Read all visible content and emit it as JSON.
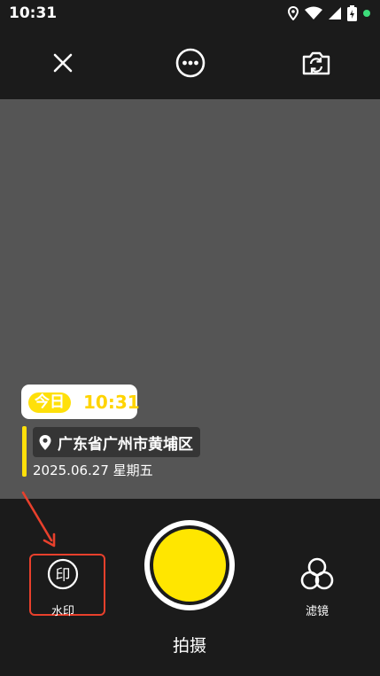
{
  "status_bar": {
    "time": "10:31"
  },
  "top_bar": {
    "close_icon": "close-icon",
    "more_icon": "more-icon",
    "switch_camera_icon": "switch-camera-icon"
  },
  "watermark_overlay": {
    "today_label": "今日",
    "time": "10:31",
    "location": "广东省广州市黄埔区",
    "date": "2025.06.27 星期五"
  },
  "bottom": {
    "watermark_label": "水印",
    "filter_label": "滤镜",
    "shoot_label": "拍摄"
  },
  "colors": {
    "accent_yellow": "#ffe600",
    "highlight_red": "#e8402c",
    "viewfinder_gray": "#555555"
  }
}
